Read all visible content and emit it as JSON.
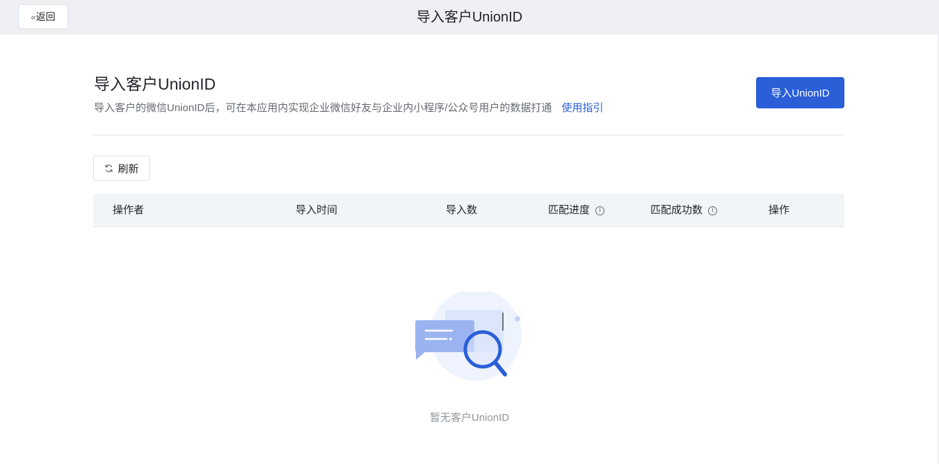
{
  "header": {
    "back_label": "返回",
    "title": "导入客户UnionID"
  },
  "main": {
    "title": "导入客户UnionID",
    "description": "导入客户的微信UnionID后，可在本应用内实现企业微信好友与企业内小程序/公众号用户的数据打通",
    "guide_link": "使用指引",
    "import_button": "导入UnionID",
    "refresh_button": "刷新"
  },
  "table": {
    "columns": [
      "操作者",
      "导入时间",
      "导入数",
      "匹配进度",
      "匹配成功数",
      "操作"
    ],
    "rows": []
  },
  "empty_state": {
    "text": "暂无客户UnionID",
    "icon": "empty-search-illustration"
  },
  "colors": {
    "accent": "#2a5fd8",
    "topbar_bg": "#eef0f3",
    "table_head_bg": "#f2f5f8"
  }
}
